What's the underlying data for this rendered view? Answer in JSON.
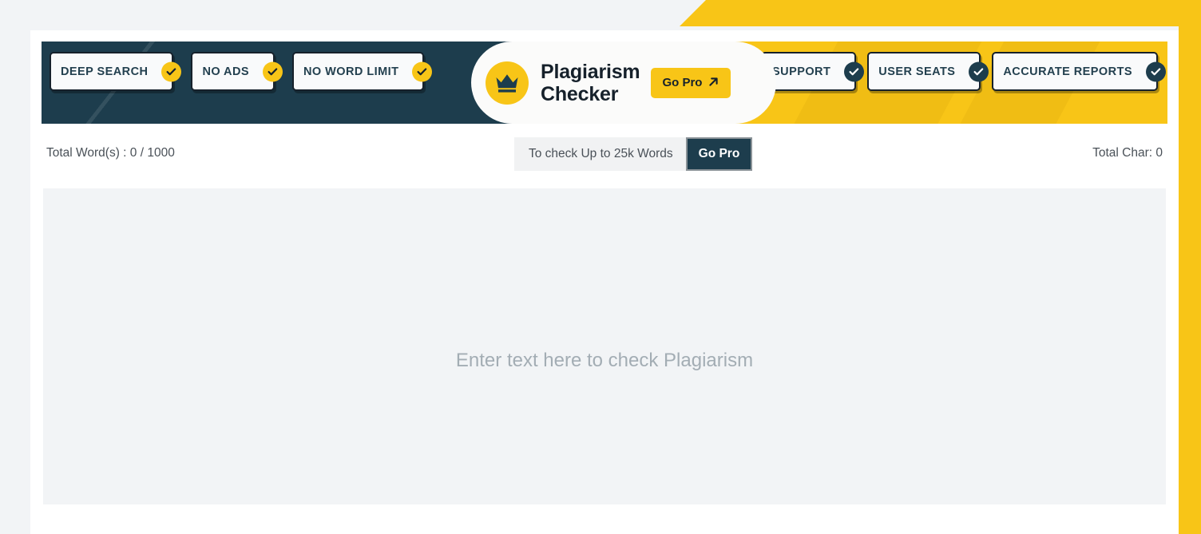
{
  "brand": {
    "title": "Plagiarism\nChecker",
    "crown_icon": "crown-icon",
    "go_pro_label": "Go Pro",
    "go_pro_arrow_icon": "arrow-up-right-icon"
  },
  "header": {
    "left_badges": [
      {
        "label": "DEEP SEARCH",
        "icon": "check-circle-icon"
      },
      {
        "label": "NO ADS",
        "icon": "check-circle-icon"
      },
      {
        "label": "NO WORD LIMIT",
        "icon": "check-circle-icon"
      }
    ],
    "right_badges": [
      {
        "label": "SUPPORT",
        "icon": "check-circle-icon"
      },
      {
        "label": "USER SEATS",
        "icon": "check-circle-icon"
      },
      {
        "label": "ACCURATE REPORTS",
        "icon": "check-circle-icon"
      }
    ]
  },
  "status": {
    "total_words": "Total Word(s) : 0 / 1000",
    "total_chars": "Total Char: 0"
  },
  "upsell": {
    "text": "To check Up to 25k Words",
    "button_label": "Go Pro"
  },
  "editor": {
    "placeholder": "Enter text here to check Plagiarism",
    "value": ""
  },
  "colors": {
    "brand_yellow": "#f8c517",
    "brand_navy": "#1d3d4d",
    "page_bg": "#f2f4f6",
    "card_bg": "#ffffff",
    "text_muted": "#4a5158",
    "placeholder": "#a3adb4"
  }
}
